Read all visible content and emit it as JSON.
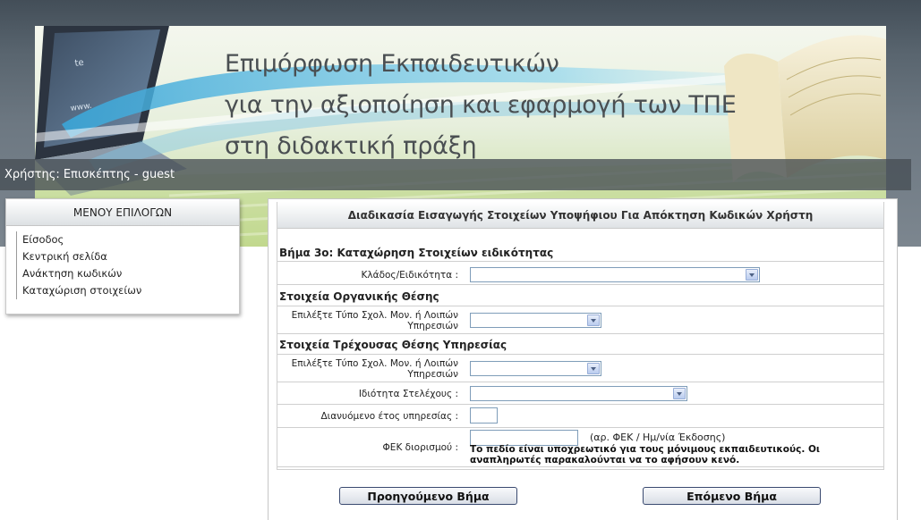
{
  "banner": {
    "line1": "Επιμόρφωση Εκπαιδευτικών",
    "line2": "για την αξιοποίηση και εφαρμογή των ΤΠΕ",
    "line3": "στη διδακτική πράξη"
  },
  "userbar": {
    "text": "Χρήστης: Επισκέπτης - guest"
  },
  "menu": {
    "title": "ΜΕΝΟΥ ΕΠΙΛΟΓΩΝ",
    "items": [
      {
        "label": "Είσοδος"
      },
      {
        "label": "Κεντρική σελίδα"
      },
      {
        "label": "Ανάκτηση κωδικών"
      },
      {
        "label": "Καταχώριση στοιχείων"
      }
    ]
  },
  "main": {
    "title": "Διαδικασία Εισαγωγής Στοιχείων Υποψήφιου Για Απόκτηση Κωδικών Χρήστη",
    "step_title": "Βήμα 3ο: Καταχώρηση Στοιχείων ειδικότητας",
    "specialty_label": "Κλάδος/Ειδικότητα :",
    "specialty_value": "",
    "organic_title": "Στοιχεία Οργανικής Θέσης",
    "organic_type_label": "Επιλέξτε Τύπο Σχολ. Μον. ή Λοιπών Υπηρεσιών",
    "organic_type_value": "",
    "current_title": "Στοιχεία Τρέχουσας Θέσης Υπηρεσίας",
    "current_type_label": "Επιλέξτε Τύπο Σχολ. Μον. ή Λοιπών Υπηρεσιών",
    "current_type_value": "",
    "capacity_label": "Ιδιότητα Στελέχους :",
    "capacity_value": "",
    "service_year_label": "Διανυόμενο έτος υπηρεσίας :",
    "service_year_value": "",
    "fek_label": "ΦΕΚ διορισμού :",
    "fek_value": "",
    "fek_hint": "(αρ. ΦΕΚ / Ημ/νία Έκδοσης)",
    "fek_warning": "Το πεδίο είναι υποχρεωτικό για τους μόνιμους εκπαιδευτικούς. Οι αναπληρωτές παρακαλούνται να το αφήσουν κενό.",
    "prev_button": "Προηγούμενο Βήμα",
    "next_button": "Επόμενο Βήμα"
  },
  "colors": {
    "header_dark": "#434e58",
    "banner_green": "#c5db98",
    "button_border": "#3a4a70",
    "select_border": "#7f9db9"
  }
}
